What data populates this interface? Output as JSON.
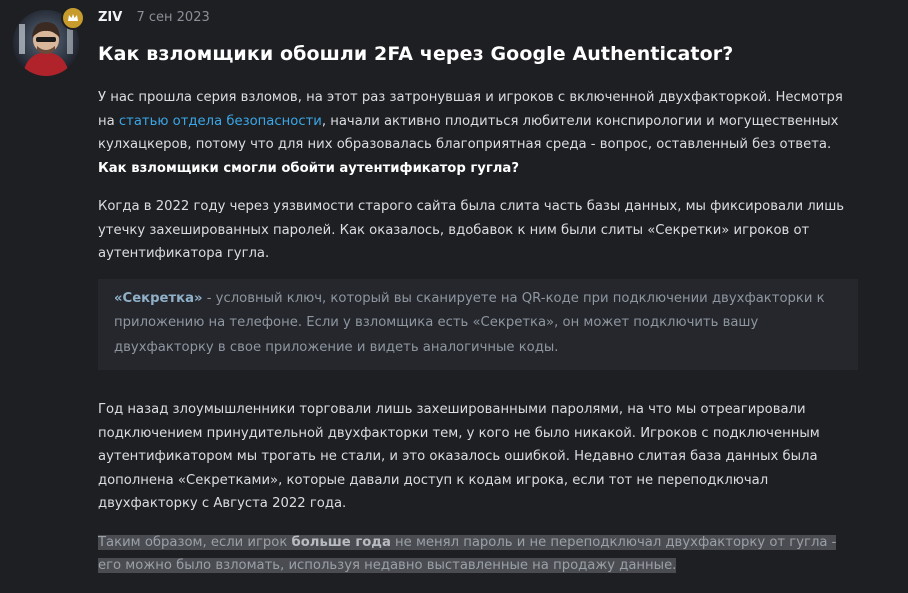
{
  "post": {
    "author": "ZIV",
    "date": "7 сен 2023",
    "title": "Как взломщики обошли 2FA через Google Authenticator?"
  },
  "p1": {
    "text_a": "У нас прошла серия взломов, на этот раз затронувшая и игроков с включенной двухфакторкой. Несмотря на ",
    "link": "статью отдела безопасности",
    "text_b": ", начали активно плодиться любители конспирологии и могущественных кулхацкеров, потому что для них образовалась благоприятная среда - вопрос, оставленный без ответа. ",
    "bold": "Как взломщики смогли обойти аутентификатор гугла?"
  },
  "p2": {
    "text": "Когда в 2022 году через уязвимости старого сайта была слита часть базы данных, мы фиксировали лишь утечку захешированных паролей. Как оказалось, вдобавок к ним были слиты «Секретки» игроков от аутентификатора гугла."
  },
  "quote": {
    "term": "«Секретка»",
    "text": " - условный ключ, который вы сканируете на QR-коде при подключении двухфакторки к приложению на телефоне. Если у взломщика есть «Секретка», он может подключить вашу двухфакторку в свое приложение и видеть аналогичные коды."
  },
  "p3": {
    "text": "Год назад злоумышленники торговали лишь захешированными паролями, на что мы отреагировали подключением принудительной двухфакторки тем, у кого не было никакой. Игроков с подключенным аутентификатором мы трогать не стали, и это оказалось ошибкой. Недавно слитая база данных была дополнена «Секретками», которые давали доступ к кодам игрока, если тот не переподключал двухфакторку с Августа 2022 года."
  },
  "p4": {
    "text_a": "Таким образом, если игрок ",
    "bold": "больше года",
    "text_b": " не менял пароль и не переподключал двухфакторку от гугла - его можно было взломать, используя недавно выставленные на продажу данные."
  },
  "colors": {
    "background": "#1e1f22",
    "link": "#3aa7e8",
    "badge": "#c79b2c",
    "quote_bg": "#25272c",
    "selection": "#4a4c51"
  },
  "icons": {
    "avatar": "user-avatar",
    "badge": "crown-icon"
  }
}
